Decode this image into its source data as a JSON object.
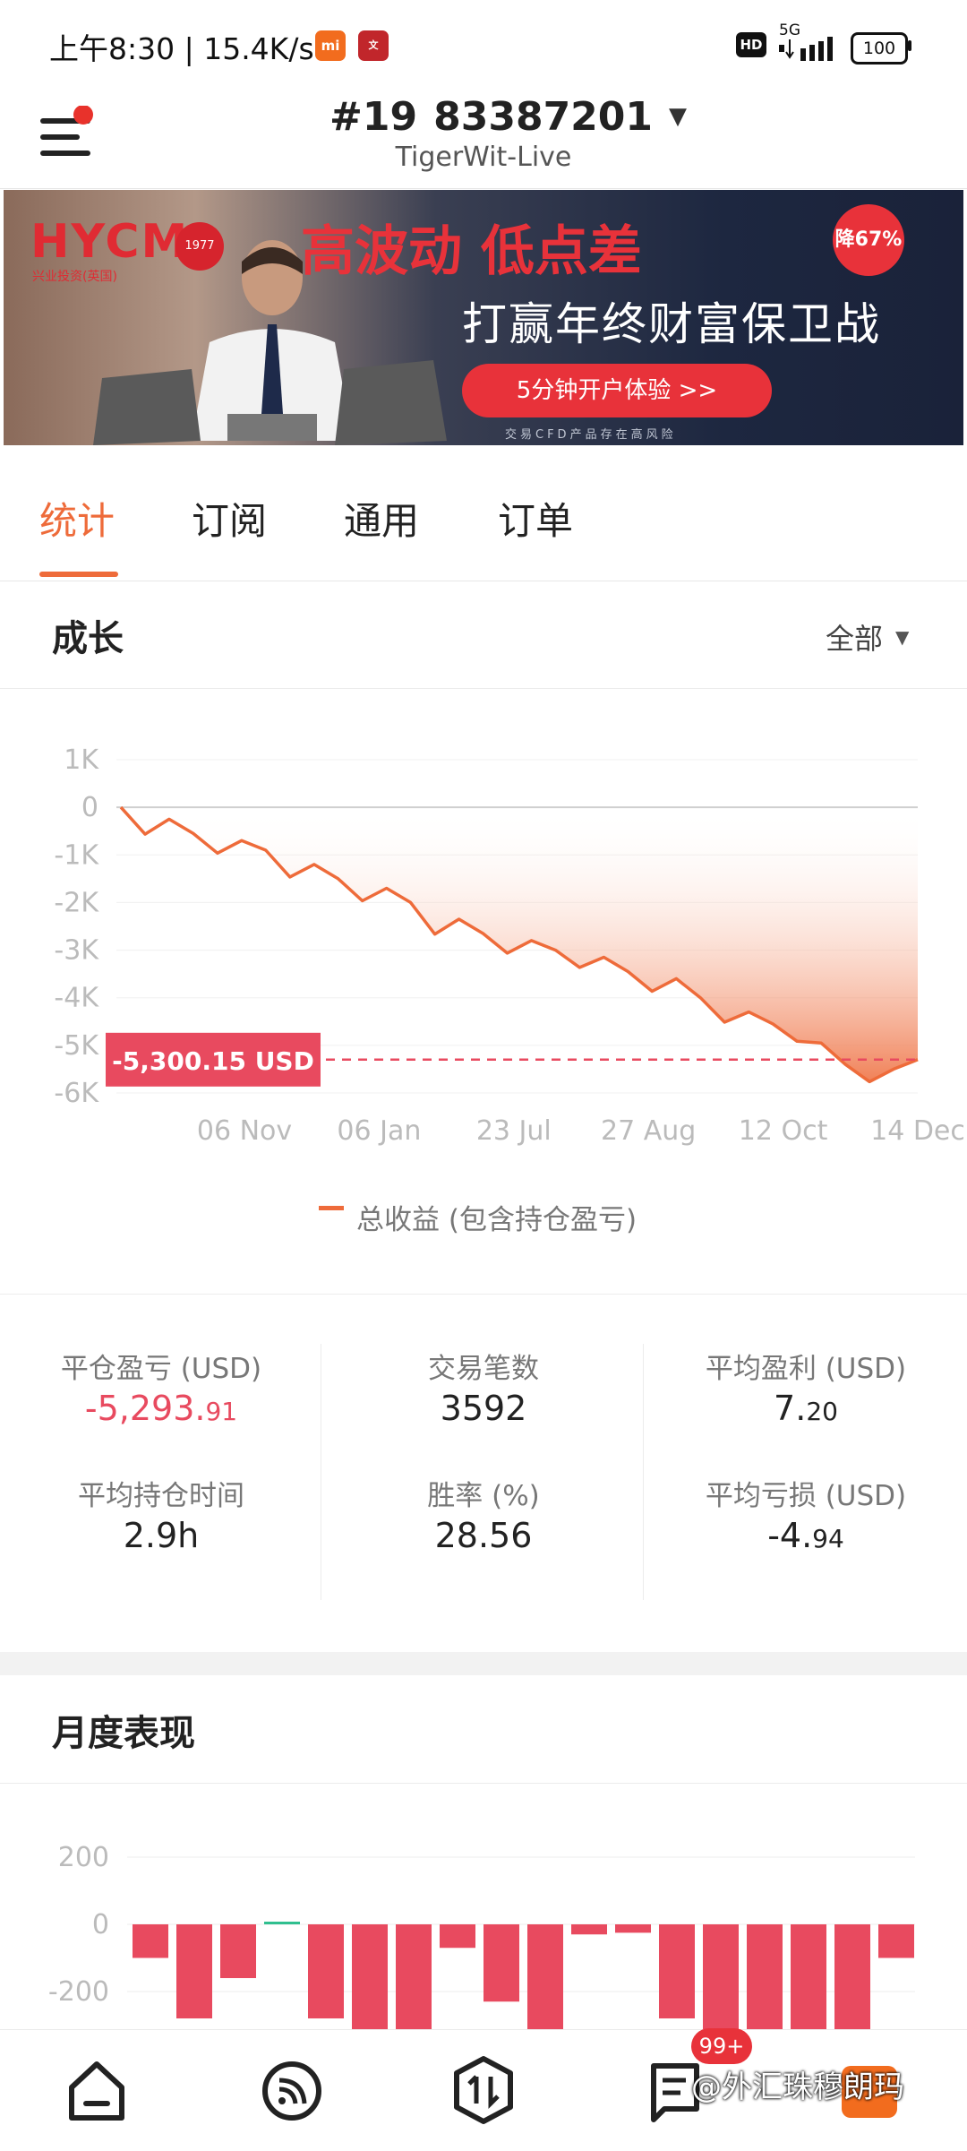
{
  "status_bar": {
    "time_text": "上午8:30 | 15.4K/s",
    "hd": "HD",
    "network": "5G",
    "battery": "100"
  },
  "header": {
    "account_prefix": "#19",
    "account_number": "83387201",
    "server": "TigerWit-Live"
  },
  "banner": {
    "brand": "HYCM",
    "brand_sub": "兴业投资(英国)",
    "since": "1977",
    "headline": "高波动 低点差",
    "badge": "降67%",
    "subheadline": "打赢年终财富保卫战",
    "cta": "5分钟开户体验 >>",
    "disclaimer": "交易CFD产品存在高风险"
  },
  "tabs": [
    {
      "label": "统计",
      "active": true
    },
    {
      "label": "订阅",
      "active": false
    },
    {
      "label": "通用",
      "active": false
    },
    {
      "label": "订单",
      "active": false
    }
  ],
  "growth": {
    "title": "成长",
    "filter": "全部",
    "current_value_label": "-5,300.15 USD",
    "legend": "总收益 (包含持仓盈亏)"
  },
  "colors": {
    "accent": "#ee6b3a",
    "loss": "#e84a5f",
    "profit": "#2fbf8f"
  },
  "chart_data": [
    {
      "type": "area",
      "x_tick_labels": [
        "06 Nov",
        "06 Jan",
        "23 Jul",
        "27 Aug",
        "12 Oct",
        "14 Dec"
      ],
      "y_tick_labels": [
        "1K",
        "0",
        "-1K",
        "-2K",
        "-3K",
        "-4K",
        "-5K",
        "-6K"
      ],
      "ylim": [
        -6000,
        1000
      ],
      "series": [
        {
          "name": "总收益 (包含持仓盈亏)",
          "y": [
            0,
            -300,
            -400,
            -550,
            -700,
            -850,
            -900,
            -1200,
            -1350,
            -1500,
            -1700,
            -1850,
            -2000,
            -2400,
            -2500,
            -2650,
            -2800,
            -2950,
            -3000,
            -3100,
            -3300,
            -3450,
            -3600,
            -3750,
            -4000,
            -4250,
            -4450,
            -4550,
            -4650,
            -5100,
            -5400,
            -5500,
            -5650,
            -5300
          ]
        }
      ],
      "reference_line": -5300.15
    },
    {
      "type": "bar",
      "y_tick_labels": [
        "200",
        "0",
        "-200"
      ],
      "series": [
        {
          "values": [
            -100,
            -280,
            -160,
            8,
            -280,
            -320,
            -320,
            -70,
            -230,
            -320,
            -30,
            -25,
            -280,
            -320,
            -320,
            -320,
            -320,
            -100
          ]
        }
      ]
    }
  ],
  "stats": [
    {
      "label": "平仓盈亏 (USD)",
      "int": "-5,293.",
      "dec": "91",
      "color": "loss"
    },
    {
      "label": "交易笔数",
      "int": "3592",
      "dec": "",
      "color": "normal"
    },
    {
      "label": "平均盈利 (USD)",
      "int": "7.",
      "dec": "20",
      "color": "normal"
    },
    {
      "label": "平均持仓时间",
      "int": "2.9h",
      "dec": "",
      "color": "normal"
    },
    {
      "label": "胜率 (%)",
      "int": "28.56",
      "dec": "",
      "color": "normal"
    },
    {
      "label": "平均亏损 (USD)",
      "int": "-4.",
      "dec": "94",
      "color": "normal"
    }
  ],
  "monthly": {
    "title": "月度表现"
  },
  "bottom_nav": {
    "badge": "99+",
    "watermark": "@外汇珠穆朗玛"
  }
}
